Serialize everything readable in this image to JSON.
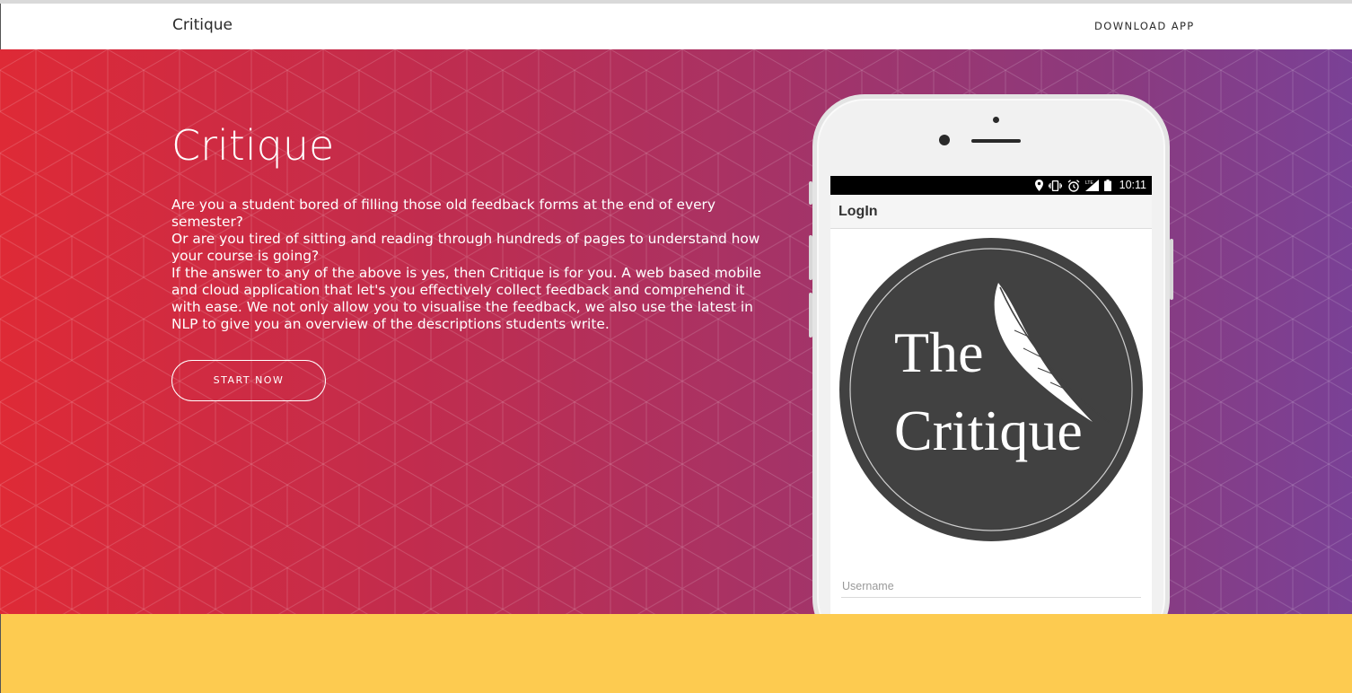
{
  "navbar": {
    "brand": "Critique",
    "download_label": "DOWNLOAD APP"
  },
  "hero": {
    "title": "Critique",
    "paragraphs": [
      "Are you a student bored of filling those old feedback forms at the end of every semester?",
      "Or are you tired of sitting and reading through hundreds of pages to understand how your course is going?",
      "If the answer to any of the above is yes, then Critique is for you. A web based mobile and cloud application that let's you effectively collect feedback and comprehend it with ease. We not only allow you to visualise the feedback, we also use the latest in NLP to give you an overview of the descriptions students write."
    ],
    "start_label": "START NOW"
  },
  "phone": {
    "status_icons": [
      "location-icon",
      "vibrate-icon",
      "alarm-icon",
      "lte-signal-icon",
      "battery-icon"
    ],
    "status_time": "10:11",
    "app_bar_title": "LogIn",
    "logo": {
      "line1": "The",
      "line2": "Critique",
      "icon": "feather-icon"
    },
    "username_placeholder": "Username"
  },
  "colors": {
    "hero_gradient_start": "#de2a36",
    "hero_gradient_end": "#7a4196",
    "footer_band": "#fdcb50",
    "logo_circle": "#414141"
  }
}
